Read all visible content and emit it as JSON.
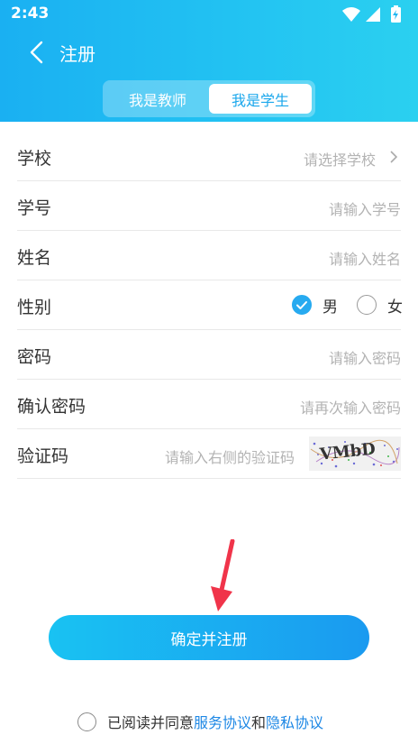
{
  "status_bar": {
    "time": "2:43"
  },
  "nav": {
    "title": "注册"
  },
  "tabs": {
    "teacher": "我是教师",
    "student": "我是学生",
    "selected": "student"
  },
  "form": {
    "school": {
      "label": "学校",
      "placeholder": "请选择学校"
    },
    "student_id": {
      "label": "学号",
      "placeholder": "请输入学号"
    },
    "name": {
      "label": "姓名",
      "placeholder": "请输入姓名"
    },
    "gender": {
      "label": "性别",
      "male": "男",
      "female": "女",
      "selected": "male"
    },
    "password": {
      "label": "密码",
      "placeholder": "请输入密码"
    },
    "confirm_password": {
      "label": "确认密码",
      "placeholder": "请再次输入密码"
    },
    "captcha": {
      "label": "验证码",
      "placeholder": "请输入右侧的验证码",
      "image_text": "VMbD"
    }
  },
  "submit": {
    "label": "确定并注册"
  },
  "agreement": {
    "prefix": "已阅读并同意",
    "service": "服务协议",
    "and": "和",
    "privacy": "隐私协议",
    "checked": false
  },
  "colors": {
    "accent": "#27aaf0",
    "link": "#1e88e5",
    "arrow": "#f0344a"
  }
}
